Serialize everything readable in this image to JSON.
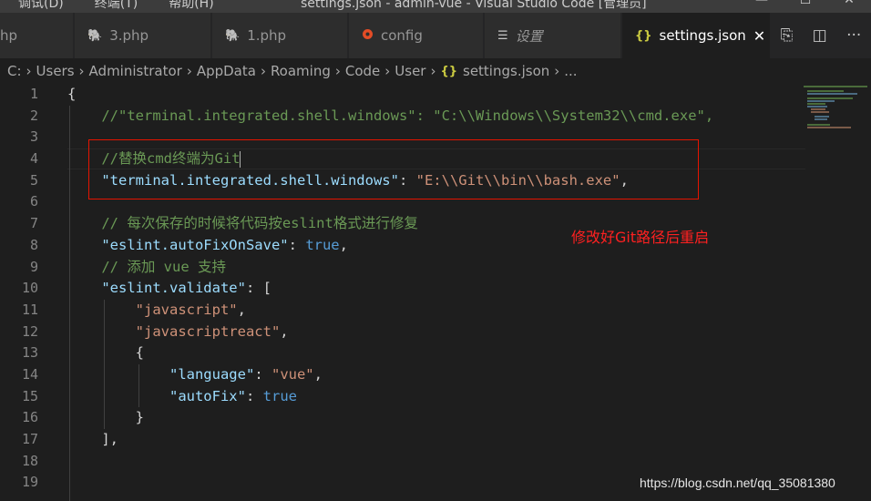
{
  "titlebar": {
    "menu": [
      "调试(D)",
      "终端(T)",
      "帮助(H)"
    ],
    "title": "settings.json - admin-vue - Visual Studio Code [管理员]"
  },
  "tabs": [
    {
      "label": "hp",
      "icon": "php-icon"
    },
    {
      "label": "3.php",
      "icon": "php-elephant-icon"
    },
    {
      "label": "1.php",
      "icon": "php-elephant-icon"
    },
    {
      "label": "config",
      "icon": "config-circle-icon"
    },
    {
      "label": "设置",
      "icon": "settings-lines-icon"
    },
    {
      "label": "settings.json",
      "icon": "json-braces-icon",
      "active": true
    }
  ],
  "breadcrumb": [
    "C:",
    "Users",
    "Administrator",
    "AppData",
    "Roaming",
    "Code",
    "User",
    "settings.json",
    "..."
  ],
  "line_numbers": [
    "1",
    "2",
    "3",
    "4",
    "5",
    "6",
    "7",
    "8",
    "9",
    "10",
    "11",
    "12",
    "13",
    "14",
    "15",
    "16",
    "17",
    "18",
    "19"
  ],
  "code": {
    "l1": "{",
    "l2": "//\"terminal.integrated.shell.windows\": \"C:\\\\Windows\\\\System32\\\\cmd.exe\",",
    "l4": "//替换cmd终端为Git",
    "l5_key": "\"terminal.integrated.shell.windows\"",
    "l5_val": "\"E:\\\\Git\\\\bin\\\\bash.exe\"",
    "l7": "// 每次保存的时候将代码按eslint格式进行修复",
    "l8_key": "\"eslint.autoFixOnSave\"",
    "l8_val": "true",
    "l9": "// 添加 vue 支持",
    "l10_key": "\"eslint.validate\"",
    "l11": "\"javascript\"",
    "l12": "\"javascriptreact\"",
    "l13": "{",
    "l14_key": "\"language\"",
    "l14_val": "\"vue\"",
    "l15_key": "\"autoFix\"",
    "l15_val": "true",
    "l16": "}",
    "l17": "],"
  },
  "annotation": "修改好Git路径后重启",
  "watermark": "https://blog.csdn.net/qq_35081380",
  "colors": {
    "comment": "#6a9955",
    "key": "#9cdcfe",
    "string": "#ce9178",
    "boolean": "#569cd6",
    "highlight_box": "#e51400"
  }
}
